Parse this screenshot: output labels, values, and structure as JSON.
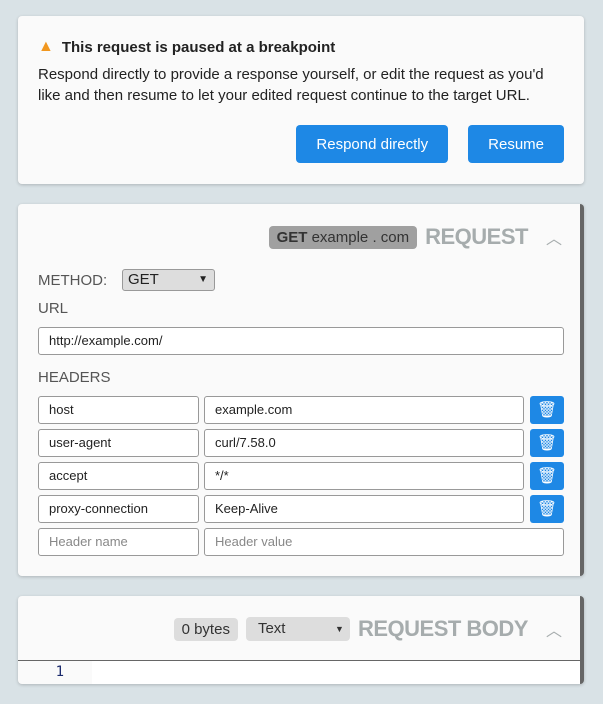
{
  "breakpoint": {
    "title": "This request is paused at a breakpoint",
    "description": "Respond directly to provide a response yourself, or edit the request as you'd like and then resume to let your edited request continue to the target URL.",
    "respond_label": "Respond directly",
    "resume_label": "Resume"
  },
  "request": {
    "summary_method": "GET",
    "summary_host": "example . com",
    "section_title": "REQUEST",
    "method_label": "METHOD:",
    "method_value": "GET",
    "url_label": "URL",
    "url_value": "http://example.com/",
    "headers_label": "HEADERS",
    "headers": [
      {
        "name": "host",
        "value": "example.com"
      },
      {
        "name": "user-agent",
        "value": "curl/7.58.0"
      },
      {
        "name": "accept",
        "value": "*/*"
      },
      {
        "name": "proxy-connection",
        "value": "Keep-Alive"
      }
    ],
    "new_header_name_placeholder": "Header name",
    "new_header_value_placeholder": "Header value"
  },
  "body": {
    "size": "0 bytes",
    "format": "Text",
    "section_title": "REQUEST BODY",
    "line_number": "1"
  },
  "colors": {
    "accent": "#1e88e5",
    "warning": "#f1971f"
  }
}
